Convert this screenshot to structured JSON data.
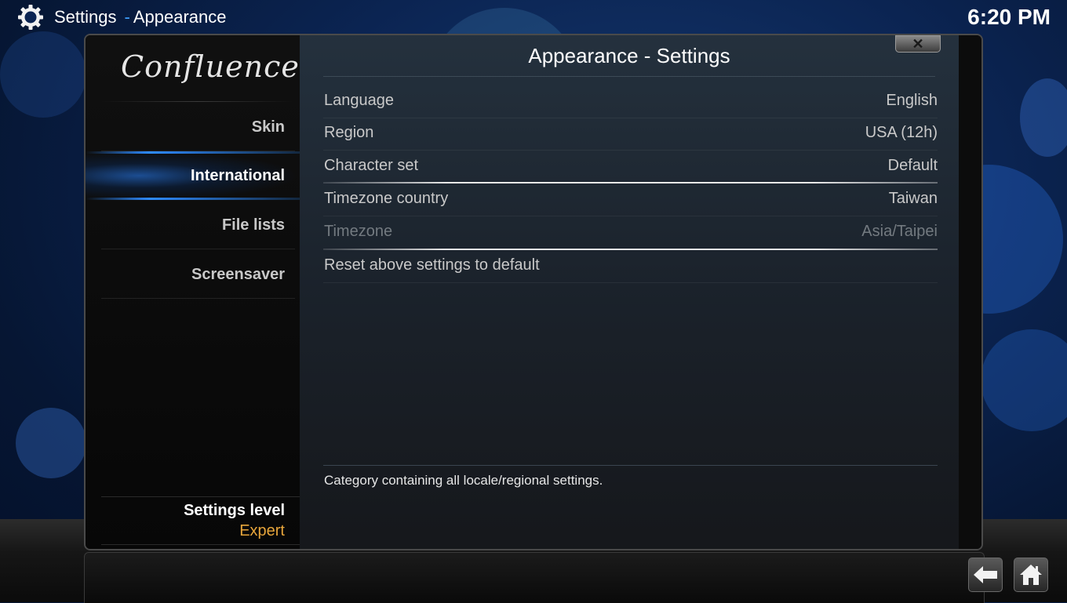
{
  "topbar": {
    "icon": "gear-icon",
    "section": "Settings",
    "separator": "-",
    "page": "Appearance",
    "clock": "6:20 PM"
  },
  "dialog": {
    "logo": "Confluence",
    "title": "Appearance - Settings",
    "close_label": "✕"
  },
  "sidebar": {
    "items": [
      {
        "label": "Skin"
      },
      {
        "label": "International"
      },
      {
        "label": "File lists"
      },
      {
        "label": "Screensaver"
      }
    ],
    "level_label": "Settings level",
    "level_value": "Expert"
  },
  "settings": [
    {
      "label": "Language",
      "value": "English"
    },
    {
      "label": "Region",
      "value": "USA (12h)"
    },
    {
      "label": "Character set",
      "value": "Default"
    },
    {
      "label": "Timezone country",
      "value": "Taiwan"
    },
    {
      "label": "Timezone",
      "value": "Asia/Taipei"
    },
    {
      "label": "Reset above settings to default",
      "value": ""
    }
  ],
  "description": "Category containing all locale/regional settings.",
  "colors": {
    "accent": "#2e8bff",
    "level_value": "#e8a63b"
  },
  "bottom_nav": {
    "back_icon": "back-arrow-icon",
    "home_icon": "home-icon"
  }
}
